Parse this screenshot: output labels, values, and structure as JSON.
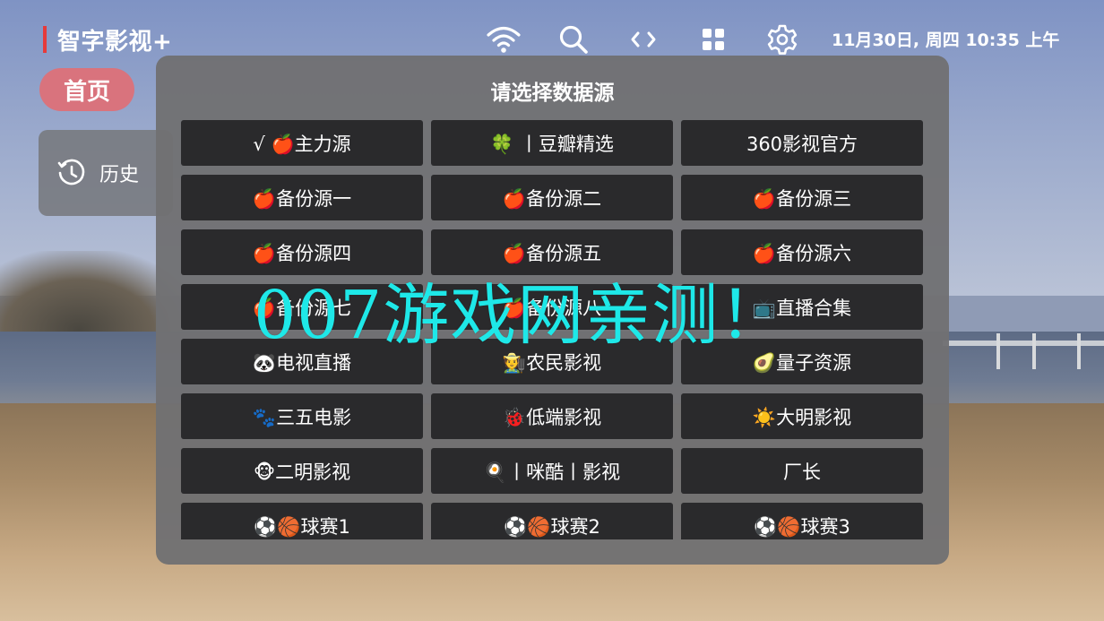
{
  "app": {
    "title": "智字影视+"
  },
  "status": {
    "datetime": "11月30日, 周四 10:35 上午"
  },
  "icons": [
    "wifi-icon",
    "search-icon",
    "code-icon",
    "grid-apps-icon",
    "settings-gear-icon"
  ],
  "nav": {
    "home_label": "首页",
    "history_label": "历史"
  },
  "dialog": {
    "title": "请选择数据源",
    "sources": [
      "√ 🍎主力源",
      "🍀 丨豆瓣精选",
      "360影视官方",
      "🍎备份源一",
      "🍎备份源二",
      "🍎备份源三",
      "🍎备份源四",
      "🍎备份源五",
      "🍎备份源六",
      "🍎备份源七",
      "🍎备份源八",
      "📺直播合集",
      "🐼电视直播",
      "🧑‍🌾农民影视",
      "🥑量子资源",
      "🐾三五电影",
      "🐞低端影视",
      "☀️大明影视",
      "🐵二明影视",
      "🍳丨咪酷丨影视",
      "厂长",
      "⚽🏀球赛1",
      "⚽🏀球赛2",
      "⚽🏀球赛3"
    ]
  },
  "watermark": "007游戏网亲测！",
  "colors": {
    "accent_red": "#e63a3a",
    "home_pill": "#d9737d",
    "dialog_bg": "#707073",
    "button_bg": "#2a2a2c",
    "watermark": "#1ee8e8"
  }
}
